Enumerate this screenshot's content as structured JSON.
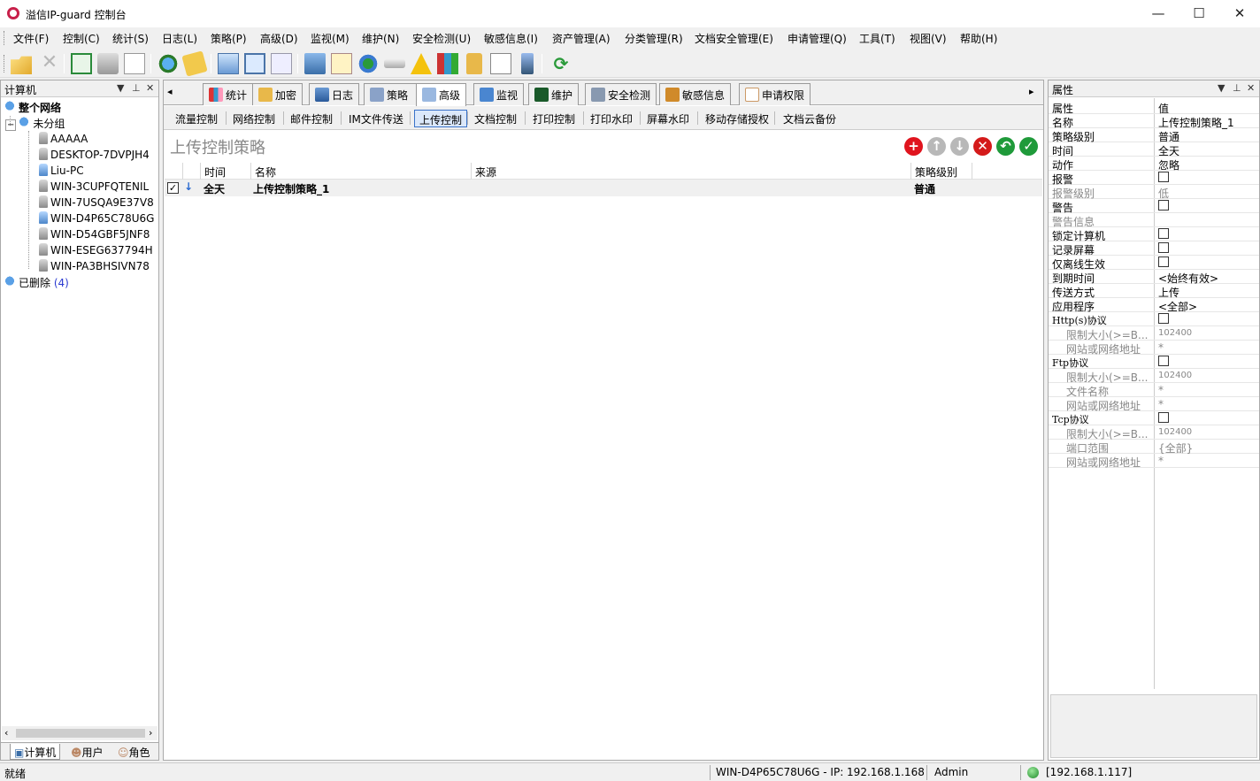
{
  "window": {
    "title": "溢信IP-guard 控制台",
    "minimize": "—",
    "maximize": "☐",
    "close": "✕"
  },
  "menu": [
    "文件(F)",
    "控制(C)",
    "统计(S)",
    "日志(L)",
    "策略(P)",
    "高级(D)",
    "监视(M)",
    "维护(N)",
    "安全检测(U)",
    "敏感信息(I)",
    "资产管理(A)",
    "分类管理(R)",
    "文档安全管理(E)",
    "申请管理(Q)",
    "工具(T)",
    "视图(V)",
    "帮助(H)"
  ],
  "left_pane": {
    "title": "计算机",
    "tree": {
      "root": "整个网络",
      "group": "未分组",
      "computers": [
        "AAAAA",
        "DESKTOP-7DVPJH4",
        "Liu-PC",
        "WIN-3CUPFQTENIL",
        "WIN-7USQA9E37V8",
        "WIN-D4P65C78U6G",
        "WIN-D54GBF5JNF8",
        "WIN-ESEG637794H",
        "WIN-PA3BHSIVN78"
      ],
      "deleted": "已删除",
      "deleted_count": "(4)"
    },
    "bottom_tabs": [
      "计算机",
      "用户",
      "角色"
    ]
  },
  "main_tabs": [
    "统计",
    "加密",
    "日志",
    "策略",
    "高级",
    "监视",
    "维护",
    "安全检测",
    "敏感信息",
    "申请权限"
  ],
  "sub_tabs": [
    "流量控制",
    "网络控制",
    "邮件控制",
    "IM文件传送",
    "上传控制",
    "文档控制",
    "打印控制",
    "打印水印",
    "屏幕水印",
    "移动存储授权",
    "文档云备份"
  ],
  "policy_title": "上传控制策略",
  "grid": {
    "headers": [
      "时间",
      "名称",
      "来源",
      "策略级别"
    ],
    "rows": [
      {
        "time": "全天",
        "name": "上传控制策略_1",
        "source": "",
        "level": "普通"
      }
    ]
  },
  "right_pane": {
    "title": "属性",
    "col_key": "属性",
    "col_val": "值",
    "props": [
      {
        "k": "名称",
        "v": "上传控制策略_1"
      },
      {
        "k": "策略级别",
        "v": "普通"
      },
      {
        "k": "时间",
        "v": "全天"
      },
      {
        "k": "动作",
        "v": "忽略"
      },
      {
        "k": "报警",
        "v": ""
      },
      {
        "k": "报警级别",
        "v": "低"
      },
      {
        "k": "警告",
        "v": ""
      },
      {
        "k": "警告信息",
        "v": ""
      },
      {
        "k": "锁定计算机",
        "v": ""
      },
      {
        "k": "记录屏幕",
        "v": ""
      },
      {
        "k": "仅离线生效",
        "v": ""
      },
      {
        "k": "到期时间",
        "v": "<始终有效>"
      },
      {
        "k": "传送方式",
        "v": "上传"
      },
      {
        "k": "应用程序",
        "v": "<全部>"
      },
      {
        "k": "Http(s)协议",
        "v": ""
      },
      {
        "k": "限制大小(>=B...",
        "v": "102400"
      },
      {
        "k": "网站或网络地址",
        "v": "*"
      },
      {
        "k": "Ftp协议",
        "v": ""
      },
      {
        "k": "限制大小(>=B...",
        "v": "102400"
      },
      {
        "k": "文件名称",
        "v": "*"
      },
      {
        "k": "网站或网络地址",
        "v": "*"
      },
      {
        "k": "Tcp协议",
        "v": ""
      },
      {
        "k": "限制大小(>=B...",
        "v": "102400"
      },
      {
        "k": "端口范围",
        "v": "{全部}"
      },
      {
        "k": "网站或网络地址",
        "v": "*"
      }
    ]
  },
  "status": {
    "ready": "就绪",
    "computer": "WIN-D4P65C78U6G - IP: 192.168.1.168",
    "user": "Admin",
    "server": "[192.168.1.117]"
  },
  "colors": {
    "add": "#e0141e",
    "disabled": "#b8b8b8",
    "delete": "#d41a1a",
    "undo": "#1f9a3a",
    "confirm": "#1f9a3a",
    "selection": "#dbe8fa"
  }
}
